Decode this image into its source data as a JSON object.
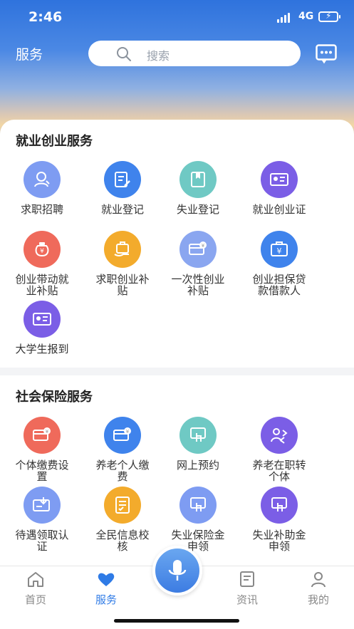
{
  "status": {
    "time": "2:46",
    "network": "4G"
  },
  "header": {
    "title": "服务",
    "search_placeholder": "搜索"
  },
  "section1": {
    "title": "就业创业服务",
    "items": [
      {
        "label": "求职招聘",
        "color": "#7e9cf2",
        "icon": "person-search-icon"
      },
      {
        "label": "就业登记",
        "color": "#3f83ec",
        "icon": "edit-document-icon"
      },
      {
        "label": "失业登记",
        "color": "#6fc9c4",
        "icon": "book-icon"
      },
      {
        "label": "就业创业证",
        "color": "#7b5ee6",
        "icon": "id-card-icon"
      },
      {
        "label": "创业带动就业补贴",
        "color": "#ef6a5b",
        "icon": "money-bag-icon"
      },
      {
        "label": "求职创业补贴",
        "color": "#f3ab2c",
        "icon": "briefcase-hand-icon"
      },
      {
        "label": "一次性创业补贴",
        "color": "#8aa6f0",
        "icon": "card-payment-icon"
      },
      {
        "label": "创业担保贷款借款人",
        "color": "#3f83ec",
        "icon": "yuan-briefcase-icon"
      },
      {
        "label": "大学生报到",
        "color": "#7b5ee6",
        "icon": "id-card-icon"
      }
    ]
  },
  "section2": {
    "title": "社会保险服务",
    "items": [
      {
        "label": "个体缴费设置",
        "color": "#ef6a5b",
        "icon": "card-payment-icon"
      },
      {
        "label": "养老个人缴费",
        "color": "#3f83ec",
        "icon": "card-payment-icon"
      },
      {
        "label": "网上预约",
        "color": "#6fc9c4",
        "icon": "hand-touch-icon"
      },
      {
        "label": "养老在职转个体",
        "color": "#7b5ee6",
        "icon": "transfer-person-icon"
      },
      {
        "label": "待遇领取认证",
        "color": "#7e9cf2",
        "icon": "certificate-icon"
      },
      {
        "label": "全民信息校核",
        "color": "#f3ab2c",
        "icon": "checklist-icon"
      },
      {
        "label": "失业保险金申领",
        "color": "#7e9cf2",
        "icon": "hand-touch-icon"
      },
      {
        "label": "失业补助金申领",
        "color": "#7b5ee6",
        "icon": "hand-touch-icon"
      }
    ]
  },
  "tabs": [
    {
      "label": "首页",
      "icon": "home-icon"
    },
    {
      "label": "服务",
      "icon": "heart-icon",
      "active": true
    },
    {
      "label": "资讯",
      "icon": "news-icon"
    },
    {
      "label": "我的",
      "icon": "user-icon"
    }
  ],
  "accent": "#2f7be6"
}
